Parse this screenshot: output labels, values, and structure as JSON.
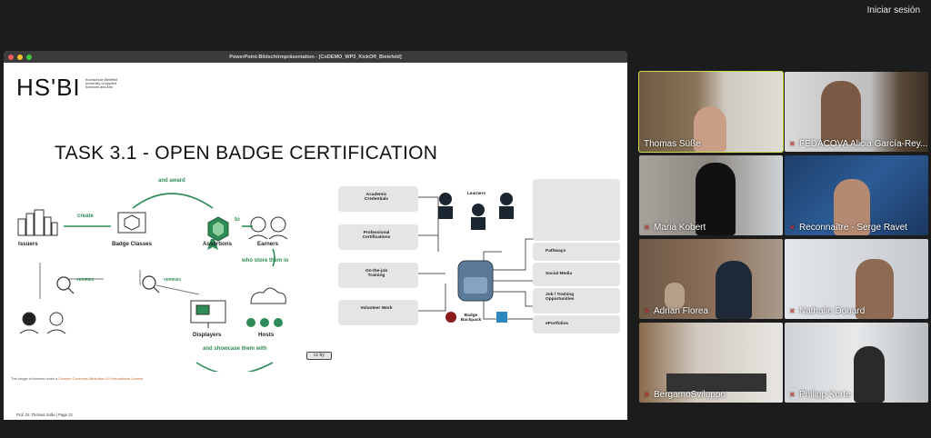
{
  "top_bar": {
    "signin_label": "Iniciar sesión"
  },
  "ppt_window": {
    "title": "PowerPoint-Bildschirmpräsentation - [CoDEMO_WP3_KickOff_Bielefeld]",
    "traffic_lights": [
      "#f25f58",
      "#fbbe2e",
      "#3bc73f"
    ]
  },
  "slide": {
    "logo_text": "HS'BI",
    "logo_subtitle": "Hochschule Bielefeld University of Applied Sciences and Arts",
    "heading": "TASK 3.1 - OPEN BADGE CERTIFICATION",
    "license_prefix": "This image is licensed under a ",
    "license_link": "Creative Commons Attribution 4.0 International License.",
    "footer": "Prof. Dr. Thomas Süße | Page 13",
    "cc_badge": "cc by",
    "left_diagram": {
      "and_award": "and award",
      "create": "create",
      "to": "to",
      "issuers": "Issuers",
      "badge_classes": "Badge Classes",
      "assertions": "Assertions",
      "earners": "Earners",
      "who_store": "who store them in",
      "verifies_1": "VERIFIES",
      "verifies_2": "VERIFIES",
      "displayers": "Displayers",
      "hosts": "Hosts",
      "and_showcase": "and showcase them with"
    },
    "right_diagram": {
      "academic": "Academic Credentials",
      "professional": "Professional Certifications",
      "onthejob": "On-the-job Training",
      "volunteer": "Volunteer Work",
      "learners": "Learners",
      "backpack": "Badge Backpack",
      "pathways": "Pathways",
      "social": "Social Media",
      "job": "Job / Training Opportunities",
      "eportfolios": "ePortfolios"
    },
    "accent_green": "#2e8b57"
  },
  "participants": [
    {
      "name": "Thomas Süße",
      "muted": false,
      "active": true
    },
    {
      "name": "FEDACOVA Alicia García-Rey...",
      "muted": true,
      "active": false
    },
    {
      "name": "Maria Kobert",
      "muted": true,
      "active": false
    },
    {
      "name": "Reconnaître - Serge Ravet",
      "muted": true,
      "active": false
    },
    {
      "name": "Adrian Florea",
      "muted": true,
      "active": false
    },
    {
      "name": "Nathalie Douard",
      "muted": true,
      "active": false
    },
    {
      "name": "BergamoSviluppo",
      "muted": true,
      "active": false
    },
    {
      "name": "Philipp Korte",
      "muted": true,
      "active": false
    }
  ],
  "tile_backgrounds": {
    "reconnaitre_words": [
      "Open",
      "Open Badges",
      "Recognition",
      "Open Learning",
      "Open Educational Resources",
      "Open Science",
      "Open Government",
      "Data"
    ]
  }
}
